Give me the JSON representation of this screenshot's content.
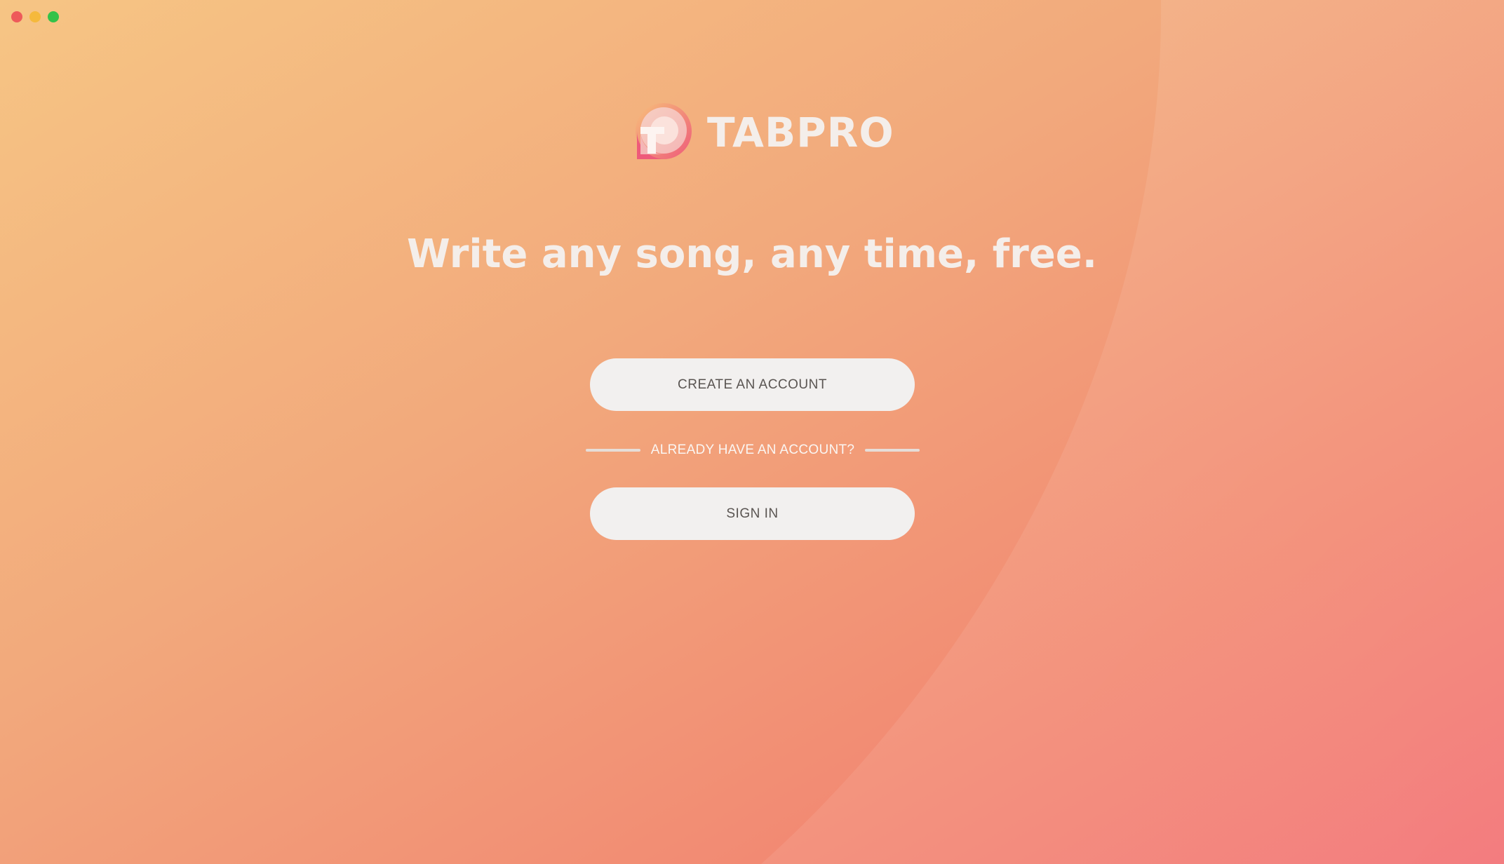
{
  "window": {
    "controls": [
      "close",
      "minimize",
      "zoom"
    ]
  },
  "brand": {
    "name": "TABPRO",
    "logo_icon": "tabpro-logo-icon"
  },
  "headline": "Write any song, any time, free.",
  "actions": {
    "create_account_label": "CREATE AN ACCOUNT",
    "divider_text": "ALREADY HAVE AN ACCOUNT?",
    "sign_in_label": "SIGN IN"
  },
  "colors": {
    "gradient_start": "#f6c584",
    "gradient_end": "#f27477",
    "button_bg": "#f2f0ef",
    "text_light": "#f4eeea"
  }
}
